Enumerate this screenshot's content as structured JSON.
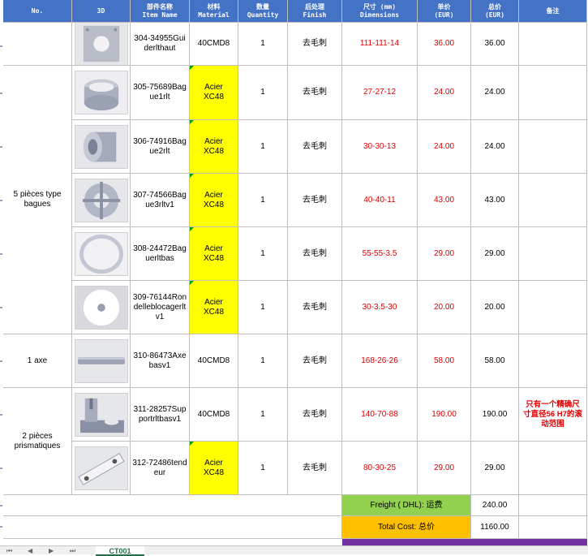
{
  "header": {
    "no": "No.",
    "three_d": "3D",
    "item_name": "部件名称\nItem Name",
    "material": "材料\nMaterial",
    "quantity": "数量\nQuantity",
    "finish": "后处理\nFinish",
    "dimensions": "尺寸 (mm)\nDimensions",
    "unit_price": "单价\n(EUR)",
    "total_price": "总价\n(EUR)",
    "remarks": "备注"
  },
  "groups": {
    "bagues": "5 pièces type bagues",
    "axe": "1 axe",
    "prismatiques": "2 pièces prismatiques"
  },
  "rows": [
    {
      "name": "304-34955Guiderlthaut",
      "material": "40CMD8",
      "qty": "1",
      "finish": "去毛刺",
      "dim": "111-111-14",
      "unit": "36.00",
      "total": "36.00",
      "note": ""
    },
    {
      "name": "305-75689Bague1rlt",
      "material": "Acier XC48",
      "qty": "1",
      "finish": "去毛刺",
      "dim": "27-27-12",
      "unit": "24.00",
      "total": "24.00",
      "note": ""
    },
    {
      "name": "306-74916Bague2rlt",
      "material": "Acier XC48",
      "qty": "1",
      "finish": "去毛刺",
      "dim": "30-30-13",
      "unit": "24.00",
      "total": "24.00",
      "note": ""
    },
    {
      "name": "307-74566Bague3rltv1",
      "material": "Acier XC48",
      "qty": "1",
      "finish": "去毛刺",
      "dim": "40-40-11",
      "unit": "43.00",
      "total": "43.00",
      "note": ""
    },
    {
      "name": "308-24472Baguerltbas",
      "material": "Acier XC48",
      "qty": "1",
      "finish": "去毛刺",
      "dim": "55-55-3.5",
      "unit": "29.00",
      "total": "29.00",
      "note": ""
    },
    {
      "name": "309-76144Rondelleblocagerltv1",
      "material": "Acier XC48",
      "qty": "1",
      "finish": "去毛刺",
      "dim": "30-3.5-30",
      "unit": "20.00",
      "total": "20.00",
      "note": ""
    },
    {
      "name": "310-86473Axebasv1",
      "material": "40CMD8",
      "qty": "1",
      "finish": "去毛刺",
      "dim": "168-26-26",
      "unit": "58.00",
      "total": "58.00",
      "note": ""
    },
    {
      "name": "311-28257Supportrltbasv1",
      "material": "40CMD8",
      "qty": "1",
      "finish": "去毛刺",
      "dim": "140-70-88",
      "unit": "190.00",
      "total": "190.00",
      "note": "只有一个精确尺寸直径56 H7的滚动范围"
    },
    {
      "name": "312-72486tendeur",
      "material": "Acier XC48",
      "qty": "1",
      "finish": "去毛刺",
      "dim": "80-30-25",
      "unit": "29.00",
      "total": "29.00",
      "note": ""
    }
  ],
  "summary": {
    "freight_label": "Freight ( DHL): 运费",
    "freight_value": "240.00",
    "total_label": "Total Cost: 总价",
    "total_value": "1160.00"
  },
  "tabs": {
    "active": "CT001"
  },
  "icons": [
    "part-304-thumbnail-icon",
    "part-305-thumbnail-icon",
    "part-306-thumbnail-icon",
    "part-307-thumbnail-icon",
    "part-308-thumbnail-icon",
    "part-309-thumbnail-icon",
    "part-310-thumbnail-icon",
    "part-311-thumbnail-icon",
    "part-312-thumbnail-icon"
  ],
  "colors": {
    "header_bg": "#4472c4",
    "material_highlight": "#ffff00",
    "price_text": "#e00000",
    "freight_bg": "#92d050",
    "total_bg": "#ffc000",
    "accent_purple": "#7030a0"
  }
}
